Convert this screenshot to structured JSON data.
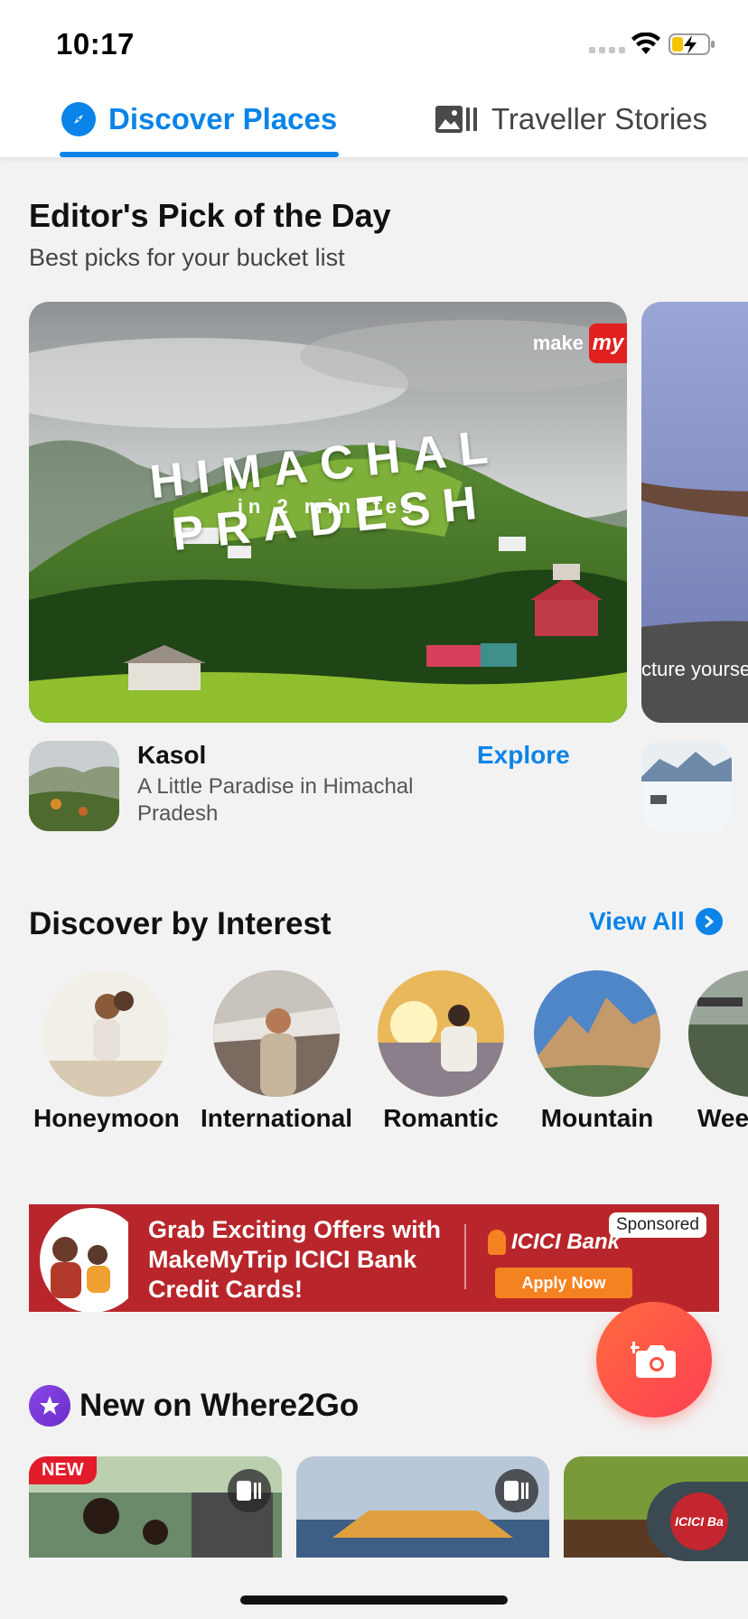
{
  "status": {
    "time": "10:17"
  },
  "tabs": [
    {
      "label": "Discover Places",
      "active": true,
      "icon": "compass-icon"
    },
    {
      "label": "Traveller Stories",
      "active": false,
      "icon": "gallery-icon"
    }
  ],
  "editors_pick": {
    "title": "Editor's Pick of the Day",
    "subtitle": "Best picks for your bucket list",
    "card": {
      "brand_make": "make",
      "brand_my": "my",
      "overlay_title": "HIMACHAL PRADESH",
      "overlay_sub": "in 2 minutes"
    },
    "next_card_caption": "cture yourse",
    "place_title": "Kasol",
    "place_desc": "A Little Paradise in Himachal Pradesh",
    "explore": "Explore"
  },
  "interest": {
    "title": "Discover by Interest",
    "view_all": "View All",
    "items": [
      {
        "label": "Honeymoon"
      },
      {
        "label": "International"
      },
      {
        "label": "Romantic"
      },
      {
        "label": "Mountain"
      },
      {
        "label": "Wee"
      }
    ]
  },
  "banner": {
    "line1": "Grab Exciting Offers with",
    "line2": "MakeMyTrip ICICI Bank",
    "line3": "Credit Cards!",
    "bank": "ICICI Bank",
    "cta": "Apply Now",
    "sponsored": "Sponsored"
  },
  "new_section": {
    "title": "New on Where2Go",
    "badge": "NEW",
    "chip": "ICICI Ba"
  },
  "colors": {
    "accent": "#0a84e8",
    "banner": "#b8262b",
    "fab": "#ff4f4f"
  }
}
